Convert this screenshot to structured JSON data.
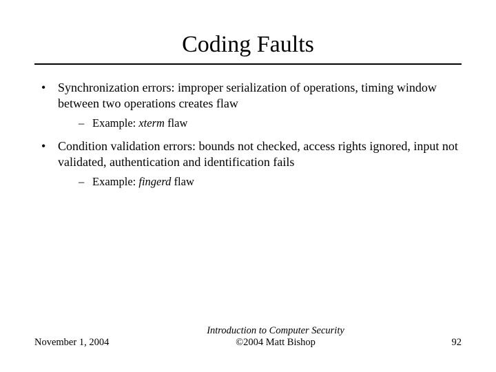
{
  "title": "Coding Faults",
  "bullets": [
    {
      "text": "Synchronization errors: improper serialization of operations, timing window between two operations creates flaw",
      "sub": {
        "prefix": "Example: ",
        "em": "xterm",
        "suffix": " flaw"
      }
    },
    {
      "text": "Condition validation errors: bounds not checked, access rights ignored, input not validated, authentication and identification fails",
      "sub": {
        "prefix": "Example: ",
        "em": "fingerd",
        "suffix": " flaw"
      }
    }
  ],
  "footer": {
    "date": "November 1, 2004",
    "center_line1": "Introduction to Computer Security",
    "center_line2": "©2004 Matt Bishop",
    "page": "92"
  }
}
